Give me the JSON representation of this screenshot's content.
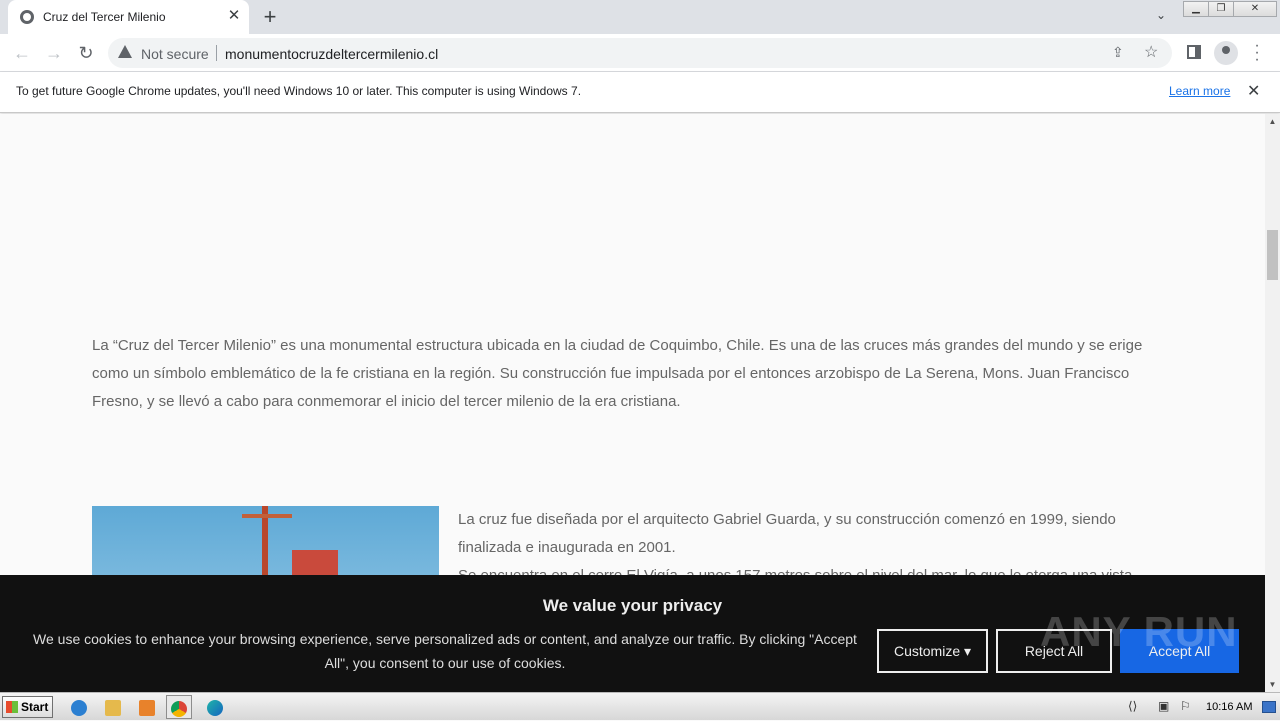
{
  "browser": {
    "tab": {
      "title": "Cruz del Tercer Milenio"
    },
    "new_tab": "+",
    "tab_menu": "⌄",
    "window_buttons": {
      "minimize": "▁",
      "restore": "❐",
      "close": "✕"
    },
    "address": {
      "security_label": "Not secure",
      "url": "monumentocruzdeltercermilenio.cl"
    },
    "infobar": {
      "message": "To get future Google Chrome updates, you'll need Windows 10 or later. This computer is using Windows 7.",
      "link": "Learn more",
      "close": "✕"
    }
  },
  "page": {
    "intro": "La “Cruz del Tercer Milenio” es una monumental estructura ubicada en la ciudad de Coquimbo, Chile. Es una de las cruces más grandes del mundo y se erige como un símbolo emblemático de la fe cristiana en la región. Su construcción fue impulsada por el entonces arzobispo de La Serena, Mons. Juan Francisco Fresno, y se llevó a cabo para conmemorar el inicio del tercer milenio de la era cristiana.",
    "paragraph2_line1": "La cruz fue diseñada por el arquitecto Gabriel Guarda, y su construcción comenzó en 1999, siendo finalizada e inaugurada en 2001.",
    "paragraph2_line2": "Se encuentra en el cerro El Vigía, a unos 157 metros sobre el nivel del mar, lo que le otorga una vista"
  },
  "cookie_banner": {
    "heading": "We value your privacy",
    "text": "We use cookies to enhance your browsing experience, serve personalized ads or content, and analyze our traffic. By clicking \"Accept All\", you consent to our use of cookies.",
    "customize": "Customize ▾",
    "reject": "Reject All",
    "accept": "Accept All"
  },
  "watermark": "ANY RUN",
  "taskbar": {
    "start": "Start",
    "clock": "10:16 AM"
  },
  "icons": [
    "globe-icon",
    "close-icon",
    "plus-icon",
    "chevron-down-icon",
    "back-arrow-icon",
    "forward-arrow-icon",
    "reload-icon",
    "warning-icon",
    "share-icon",
    "star-icon",
    "side-panel-icon",
    "profile-icon",
    "kebab-menu-icon"
  ]
}
